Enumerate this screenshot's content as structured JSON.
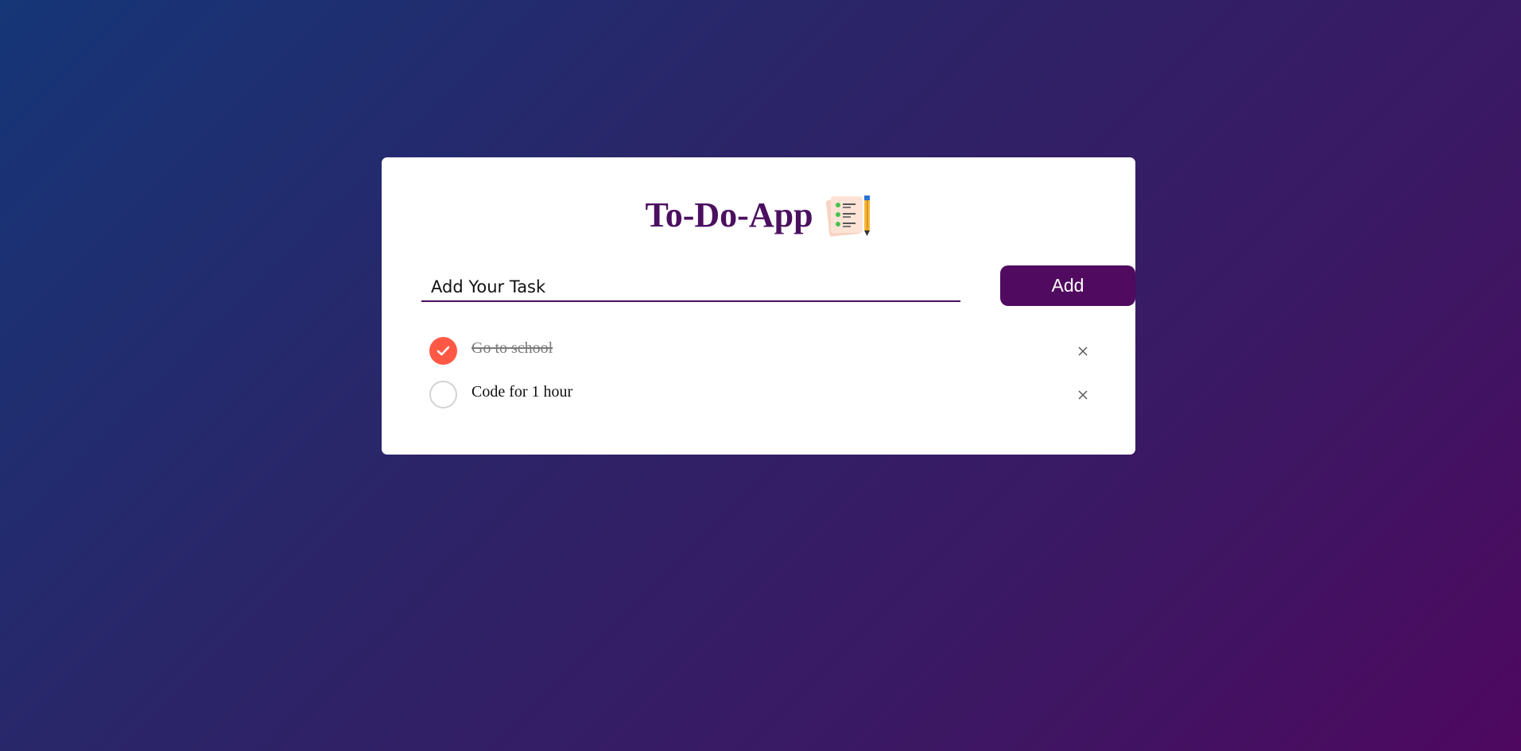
{
  "app": {
    "title": "To-Do-App",
    "title_icon": "notepad-pencil-icon"
  },
  "input": {
    "placeholder": "Add Your Task",
    "value": ""
  },
  "add_button": {
    "label": "Add"
  },
  "tasks": [
    {
      "label": "Go to school",
      "done": true,
      "remove_icon": "close-icon"
    },
    {
      "label": "Code for 1 hour",
      "done": false,
      "remove_icon": "close-icon"
    }
  ],
  "colors": {
    "accent": "#500a5f",
    "checked": "#ff5945",
    "background_start": "#153677",
    "background_end": "#4e085f"
  }
}
